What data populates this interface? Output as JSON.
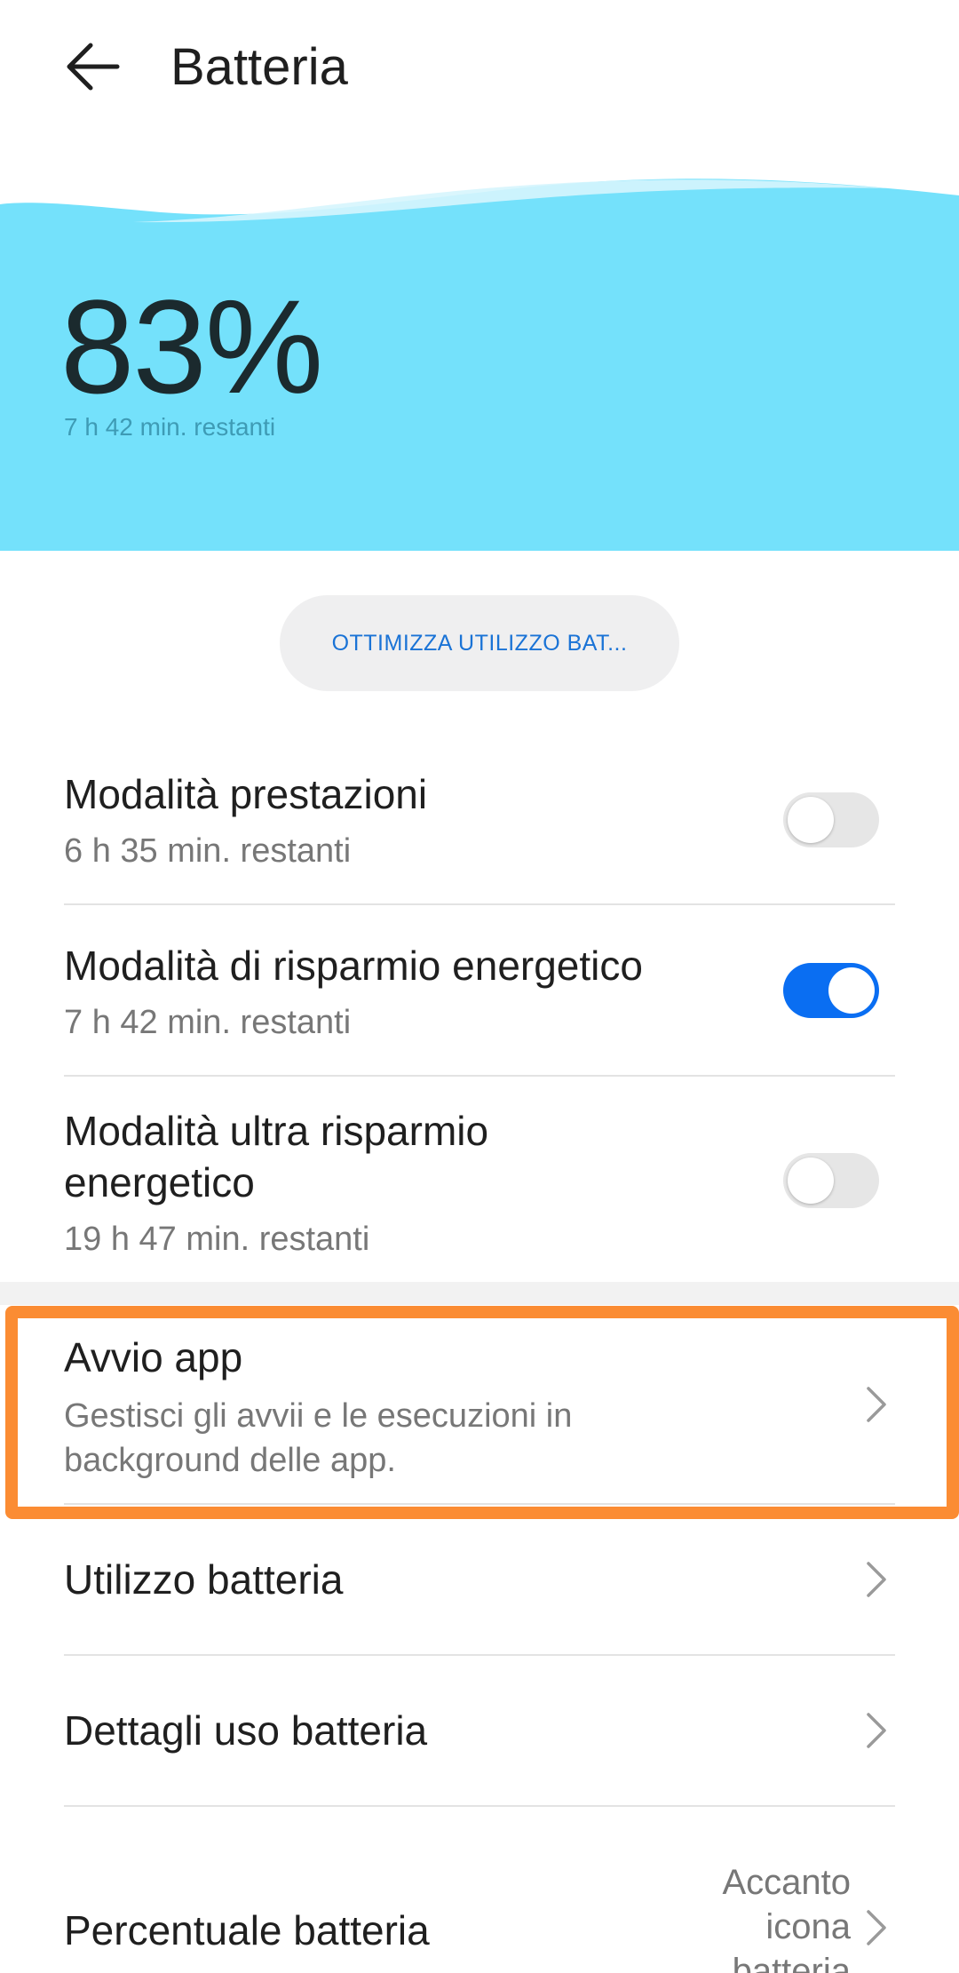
{
  "header": {
    "title": "Batteria",
    "back_icon": "arrow-left-icon"
  },
  "battery": {
    "percent": "83%",
    "remaining": "7 h 42 min. restanti",
    "level": 0.83,
    "color": "#74e1fb"
  },
  "optimize": {
    "label": "OTTIMIZZA UTILIZZO BAT..."
  },
  "modes": [
    {
      "title": "Modalità prestazioni",
      "subtitle": "6 h 35 min. restanti",
      "enabled": false
    },
    {
      "title": "Modalità di risparmio energetico",
      "subtitle": "7 h 42 min. restanti",
      "enabled": true
    },
    {
      "title_line1": "Modalità ultra risparmio",
      "title_line2": "energetico",
      "subtitle": "19 h 47 min. restanti",
      "enabled": false
    }
  ],
  "settings": {
    "app_launch": {
      "title": "Avvio app",
      "subtitle_line1": "Gestisci gli avvii e le esecuzioni in",
      "subtitle_line2": "background delle app."
    },
    "battery_usage": {
      "title": "Utilizzo batteria"
    },
    "battery_details": {
      "title": "Dettagli uso batteria"
    },
    "battery_percentage": {
      "title": "Percentuale batteria",
      "value_line1": "Accanto",
      "value_line2": "icona",
      "value_line3": "batteria"
    }
  },
  "colors": {
    "accent": "#0a6ef2",
    "highlight": "#fb8c33",
    "link": "#1a73d6"
  }
}
